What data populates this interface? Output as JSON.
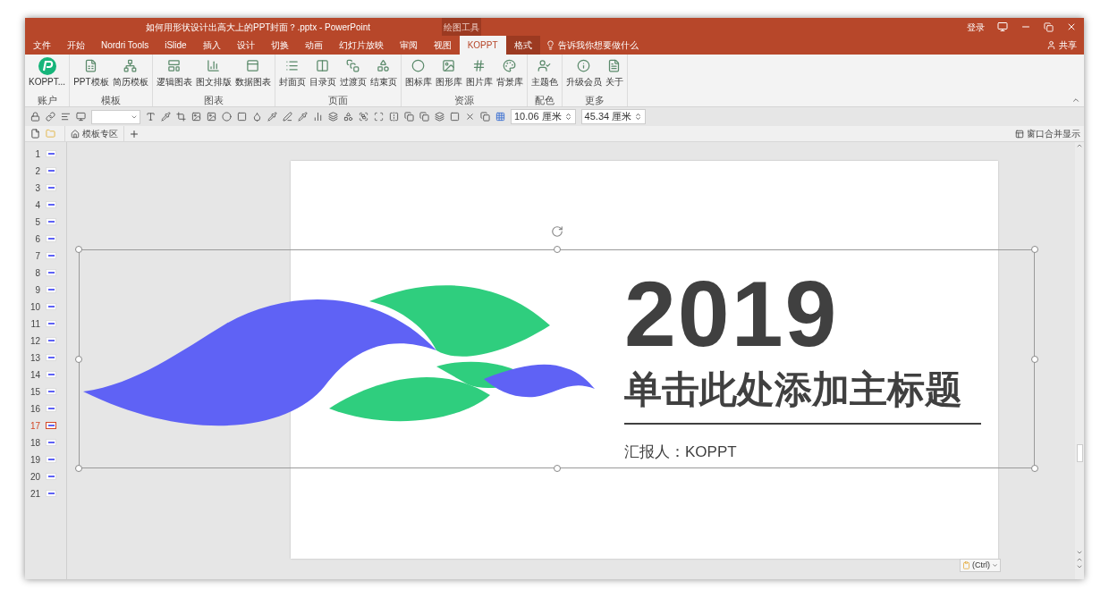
{
  "window": {
    "title": "如何用形状设计出高大上的PPT封面？.pptx  -  PowerPoint",
    "context_label": "绘图工具",
    "sign_in": "登录"
  },
  "tabs": [
    {
      "label": "文件",
      "kind": "normal",
      "selected": false
    },
    {
      "label": "开始",
      "kind": "normal",
      "selected": false
    },
    {
      "label": "Nordri Tools",
      "kind": "normal",
      "selected": false
    },
    {
      "label": "iSlide",
      "kind": "normal",
      "selected": false
    },
    {
      "label": "插入",
      "kind": "normal",
      "selected": false
    },
    {
      "label": "设计",
      "kind": "normal",
      "selected": false
    },
    {
      "label": "切换",
      "kind": "normal",
      "selected": false
    },
    {
      "label": "动画",
      "kind": "normal",
      "selected": false
    },
    {
      "label": "幻灯片放映",
      "kind": "normal",
      "selected": false
    },
    {
      "label": "审阅",
      "kind": "normal",
      "selected": false
    },
    {
      "label": "视图",
      "kind": "normal",
      "selected": false
    },
    {
      "label": "KOPPT",
      "kind": "normal",
      "selected": true
    },
    {
      "label": "格式",
      "kind": "contextual",
      "selected": false
    }
  ],
  "tell_me": {
    "placeholder": "告诉我你想要做什么"
  },
  "share": "共享",
  "ribbon": [
    {
      "label": "账户",
      "buttons": [
        {
          "label": "KOPPT...",
          "kind": "logo"
        }
      ]
    },
    {
      "label": "模板",
      "buttons": [
        {
          "label": "PPT模板",
          "kind": "icon"
        },
        {
          "label": "简历模板",
          "kind": "icon"
        }
      ]
    },
    {
      "label": "图表",
      "buttons": [
        {
          "label": "逻辑图表",
          "kind": "icon"
        },
        {
          "label": "图文排版",
          "kind": "icon"
        },
        {
          "label": "数据图表",
          "kind": "icon"
        }
      ]
    },
    {
      "label": "页面",
      "buttons": [
        {
          "label": "封面页",
          "kind": "icon"
        },
        {
          "label": "目录页",
          "kind": "icon"
        },
        {
          "label": "过渡页",
          "kind": "icon"
        },
        {
          "label": "结束页",
          "kind": "icon"
        }
      ]
    },
    {
      "label": "资源",
      "buttons": [
        {
          "label": "图标库",
          "kind": "icon"
        },
        {
          "label": "图形库",
          "kind": "icon"
        },
        {
          "label": "图片库",
          "kind": "icon"
        },
        {
          "label": "背景库",
          "kind": "icon"
        }
      ]
    },
    {
      "label": "配色",
      "buttons": [
        {
          "label": "主题色",
          "kind": "icon"
        }
      ]
    },
    {
      "label": "更多",
      "buttons": [
        {
          "label": "升级会员",
          "kind": "icon"
        },
        {
          "label": "关于",
          "kind": "icon"
        }
      ]
    }
  ],
  "format_bar": {
    "height": "10.06 厘米",
    "width": "45.34 厘米"
  },
  "doc_tabs": {
    "template_tab": "模板专区",
    "merge_windows": "窗口合并显示"
  },
  "slides": [
    {
      "number": "1",
      "selected": false
    },
    {
      "number": "2",
      "selected": false
    },
    {
      "number": "3",
      "selected": false
    },
    {
      "number": "4",
      "selected": false
    },
    {
      "number": "5",
      "selected": false
    },
    {
      "number": "6",
      "selected": false
    },
    {
      "number": "7",
      "selected": false
    },
    {
      "number": "8",
      "selected": false
    },
    {
      "number": "9",
      "selected": false
    },
    {
      "number": "10",
      "selected": false
    },
    {
      "number": "11",
      "selected": false
    },
    {
      "number": "12",
      "selected": false
    },
    {
      "number": "13",
      "selected": false
    },
    {
      "number": "14",
      "selected": false
    },
    {
      "number": "15",
      "selected": false
    },
    {
      "number": "16",
      "selected": false
    },
    {
      "number": "17",
      "selected": true
    },
    {
      "number": "18",
      "selected": false
    },
    {
      "number": "19",
      "selected": false
    },
    {
      "number": "20",
      "selected": false
    },
    {
      "number": "21",
      "selected": false
    }
  ],
  "slide": {
    "year": "2019",
    "title": "单击此处添加主标题",
    "reporter": "汇报人：KOPPT"
  },
  "paste_options": "(Ctrl)"
}
